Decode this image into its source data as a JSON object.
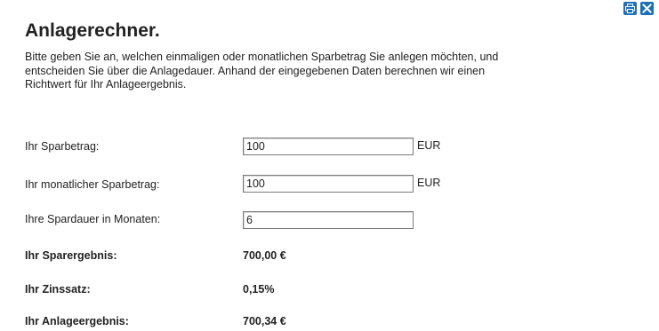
{
  "toolbar": {
    "print_icon": "printer-icon",
    "close_icon": "close-icon",
    "accent": "#1e6fb8"
  },
  "page": {
    "title": "Anlagerechner.",
    "intro": "Bitte geben Sie an, welchen einmaligen oder monatlichen Sparbetrag Sie anlegen möchten, und entscheiden Sie über die Anlagedauer. Anhand der eingegebenen Daten berechnen wir einen Richtwert für Ihr Anlageergebnis."
  },
  "form": {
    "sparbetrag": {
      "label": "Ihr Sparbetrag:",
      "value": "100",
      "unit": "EUR"
    },
    "monatlich": {
      "label": "Ihr monatlicher Sparbetrag:",
      "value": "100",
      "unit": "EUR"
    },
    "dauer": {
      "label": "Ihre Spardauer in Monaten:",
      "value": "6"
    }
  },
  "results": {
    "sparergebnis": {
      "label": "Ihr Sparergebnis:",
      "value": "700,00 €"
    },
    "zinssatz": {
      "label": "Ihr Zinssatz:",
      "value": "0,15%"
    },
    "anlageergebnis": {
      "label": "Ihr Anlageergebnis:",
      "value": "700,34 €"
    }
  }
}
